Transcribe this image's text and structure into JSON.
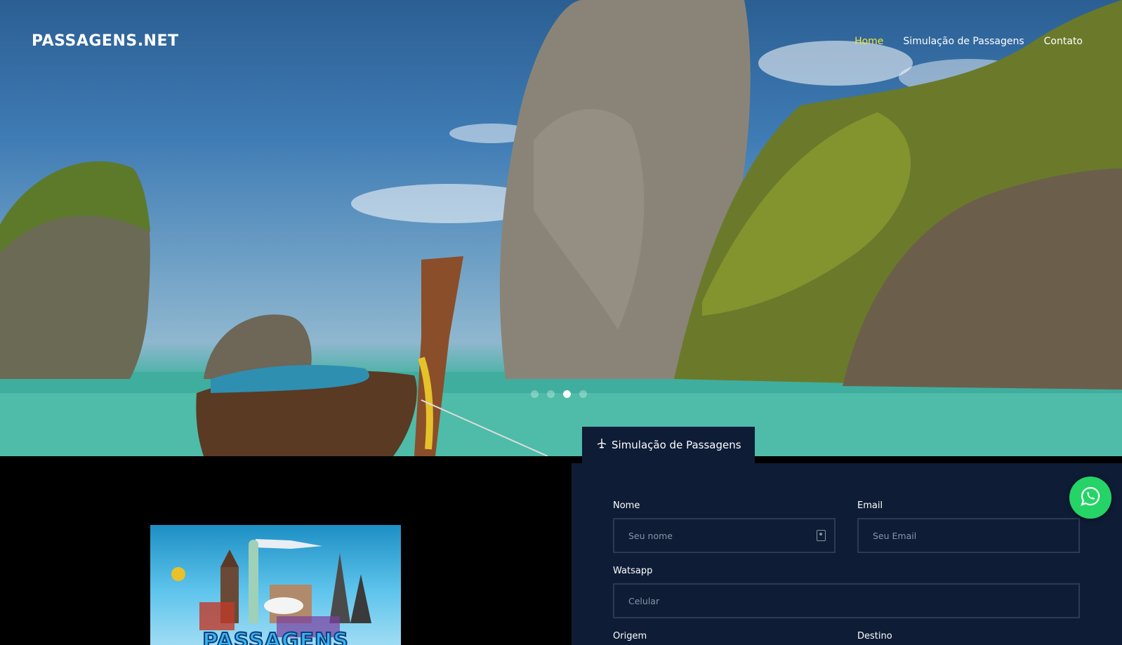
{
  "header": {
    "brand": "PASSAGENS.NET",
    "nav": [
      {
        "label": "Home",
        "active": true
      },
      {
        "label": "Simulação de Passagens",
        "active": false
      },
      {
        "label": "Contato",
        "active": false
      }
    ]
  },
  "carousel": {
    "slide_count": 4,
    "active_index": 2
  },
  "promo": {
    "word": "PASSAGENS"
  },
  "form": {
    "tab_label": "Simulação de Passagens",
    "tab_icon": "airplane-icon",
    "fields": {
      "nome": {
        "label": "Nome",
        "placeholder": "Seu nome"
      },
      "email": {
        "label": "Email",
        "placeholder": "Seu Email"
      },
      "whatsapp": {
        "label": "Watsapp",
        "placeholder": "Celular"
      },
      "origem": {
        "label": "Origem"
      },
      "destino": {
        "label": "Destino"
      }
    }
  },
  "whatsapp_button": {
    "icon": "whatsapp-icon"
  },
  "colors": {
    "accent": "#f3e43a",
    "panel": "#0e1c36",
    "whatsapp": "#25d366"
  }
}
